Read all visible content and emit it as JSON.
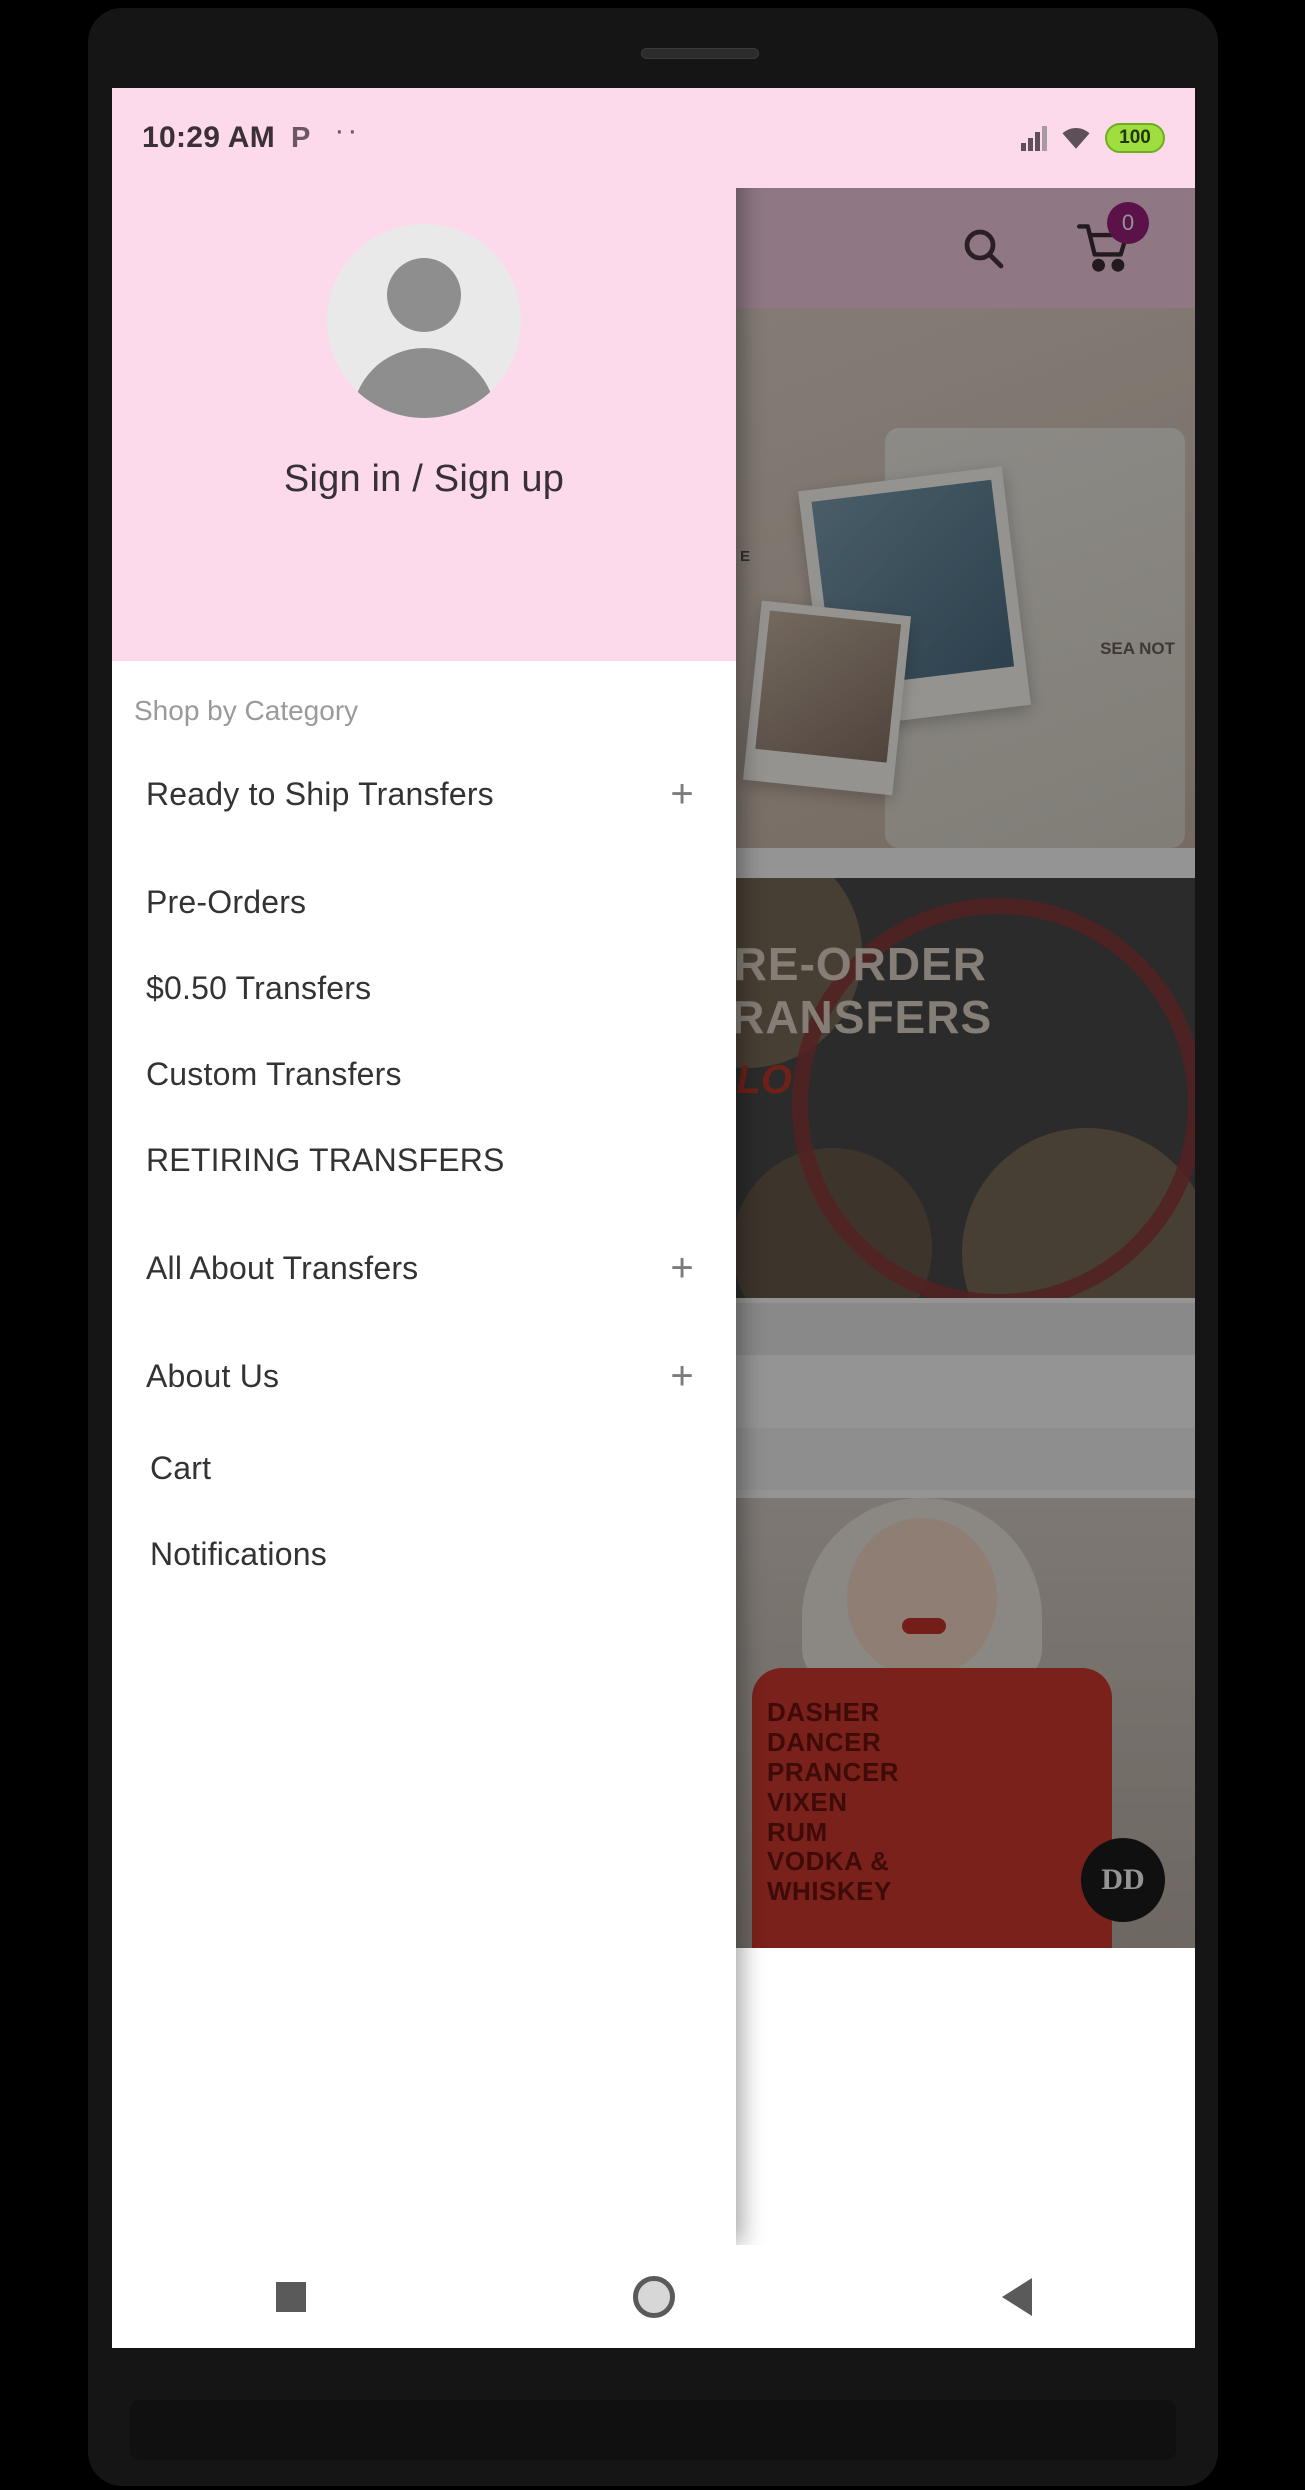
{
  "status_bar": {
    "time": "10:29 AM",
    "app_icon": "P",
    "more_notifications_icon": "··",
    "signal_icon": "signal-bars-icon",
    "wifi_icon": "wifi-icon",
    "battery_level": "100"
  },
  "app": {
    "toolbar": {
      "search_icon": "search-icon",
      "cart_icon": "cart-icon",
      "cart_count": "0"
    },
    "hero": {
      "tee_text_right": "SEA\nNOT",
      "tee_text_left": "THE\nA\nE"
    },
    "preorder_banner": {
      "title": "PRE-ORDER\nTRANSFERS",
      "subtitle": "LLO"
    },
    "model_card": {
      "shirt_text": "DASHER\nDANCER\nPRANCER\nVIXEN\nRUM\nVODKA &\nWHISKEY",
      "logo_text": "DD"
    }
  },
  "drawer": {
    "account": {
      "avatar_icon": "person-avatar-icon",
      "label": "Sign in / Sign up"
    },
    "section_label": "Shop by Category",
    "items": [
      {
        "label": "Ready to Ship Transfers",
        "expandable": true,
        "expand_icon": "+",
        "indent": 1
      },
      {
        "label": "Pre-Orders",
        "expandable": false,
        "expand_icon": "",
        "indent": 1
      },
      {
        "label": "$0.50 Transfers",
        "expandable": false,
        "expand_icon": "",
        "indent": 1
      },
      {
        "label": "Custom Transfers",
        "expandable": false,
        "expand_icon": "",
        "indent": 1
      },
      {
        "label": "RETIRING TRANSFERS",
        "expandable": false,
        "expand_icon": "",
        "indent": 1
      },
      {
        "label": "All About Transfers",
        "expandable": true,
        "expand_icon": "+",
        "indent": 1
      },
      {
        "label": "About Us",
        "expandable": true,
        "expand_icon": "+",
        "indent": 1
      },
      {
        "label": "Cart",
        "expandable": false,
        "expand_icon": "",
        "indent": 2
      },
      {
        "label": "Notifications",
        "expandable": false,
        "expand_icon": "",
        "indent": 2
      }
    ]
  },
  "nav_bar": {
    "recents_icon": "square-recents-icon",
    "home_icon": "circle-home-icon",
    "back_icon": "triangle-back-icon"
  },
  "colors": {
    "header_pink": "#fcd9eb",
    "toolbar_pink": "#f7cfe3",
    "badge_magenta": "#9c1f7e",
    "battery_green": "#9ede3f",
    "text_dark": "#333333",
    "text_muted": "#9a9a9a"
  }
}
